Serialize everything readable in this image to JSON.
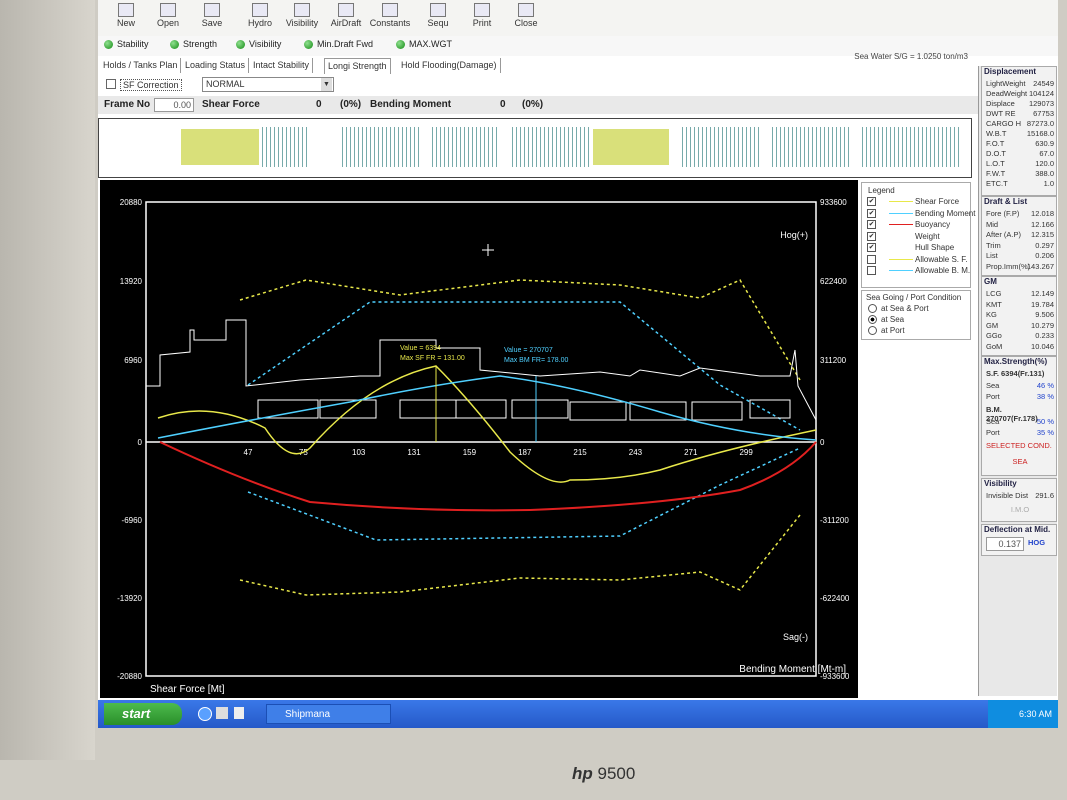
{
  "toolbar": {
    "buttons": [
      {
        "label": "New",
        "icon": "new-file-icon"
      },
      {
        "label": "Open",
        "icon": "open-folder-icon"
      },
      {
        "label": "Save",
        "icon": "save-disk-icon"
      },
      {
        "label": "Hydro",
        "icon": "hydro-table-icon"
      },
      {
        "label": "Visibility",
        "icon": "visibility-icon"
      },
      {
        "label": "AirDraft",
        "icon": "airdraft-icon"
      },
      {
        "label": "Constants",
        "icon": "constants-icon"
      },
      {
        "label": "Sequ",
        "icon": "sequence-icon"
      },
      {
        "label": "Print",
        "icon": "printer-icon"
      },
      {
        "label": "Close",
        "icon": "close-icon"
      }
    ]
  },
  "status_buttons": [
    "Stability",
    "Strength",
    "Visibility",
    "Min.Draft Fwd",
    "MAX.WGT"
  ],
  "sea_water": "Sea Water S/G = 1.0250 ton/m3",
  "tabs": [
    "Holds / Tanks Plan",
    "Loading Status",
    "Intact Stability",
    "Longi Strength",
    "Hold Flooding(Damage)"
  ],
  "active_tab": "Longi Strength",
  "sf_correction": "SF Correction",
  "mode_select": "NORMAL",
  "frame": {
    "label": "Frame No",
    "value": "0.00"
  },
  "shear_force": {
    "label": "Shear Force",
    "value": "0",
    "pct": "(0%)"
  },
  "bending_moment": {
    "label": "Bending Moment",
    "value": "0",
    "pct": "(0%)"
  },
  "chart_axes": {
    "left_ticks": [
      "20880",
      "13920",
      "6960",
      "0",
      "-6960",
      "-13920",
      "-20880"
    ],
    "right_ticks": [
      "933600",
      "622400",
      "311200",
      "0",
      "-311200",
      "-622400",
      "-933600"
    ],
    "x_ticks": [
      "47",
      "75",
      "103",
      "131",
      "159",
      "187",
      "215",
      "243",
      "271",
      "299"
    ],
    "hog": "Hog(+)",
    "sag": "Sag(-)",
    "xlabel": "Shear Force [Mt]",
    "xlabel_right": "Bending Moment [Mt-m]"
  },
  "annot_sf": {
    "value": "Value = 6394",
    "max": "Max SF FR = 131.00"
  },
  "annot_bm": {
    "value": "Value = 270707",
    "max": "Max BM FR= 178.00"
  },
  "legend": {
    "title": "Legend",
    "items": [
      {
        "label": "Shear Force",
        "color": "#e8e84a",
        "checked": true
      },
      {
        "label": "Bending Moment",
        "color": "#4fd0ff",
        "checked": true
      },
      {
        "label": "Buoyancy",
        "color": "#e02020",
        "checked": true
      },
      {
        "label": "Weight",
        "color": "#ffffff",
        "checked": true
      },
      {
        "label": "Hull Shape",
        "color": "#ffffff",
        "checked": true
      },
      {
        "label": "Allowable S. F.",
        "color": "#e8e84a",
        "checked": false
      },
      {
        "label": "Allowable B. M.",
        "color": "#4fd0ff",
        "checked": false
      }
    ]
  },
  "condition": {
    "title": "Sea Going / Port Condition",
    "options": [
      "at Sea & Port",
      "at Sea",
      "at Port"
    ],
    "selected": "at Sea"
  },
  "displacement": {
    "title": "Displacement",
    "rows": [
      [
        "LightWeight",
        "24549"
      ],
      [
        "DeadWeight",
        "104124"
      ],
      [
        "Displace",
        "129073"
      ],
      [
        "DWT RE",
        "67753"
      ],
      [
        "CARGO H",
        "87273.0"
      ],
      [
        "W.B.T",
        "15168.0"
      ],
      [
        "F.O.T",
        "630.9"
      ],
      [
        "D.O.T",
        "67.0"
      ],
      [
        "L.O.T",
        "120.0"
      ],
      [
        "F.W.T",
        "388.0"
      ],
      [
        "ETC.T",
        "1.0"
      ]
    ]
  },
  "draft": {
    "title": "Draft & List",
    "rows": [
      [
        "Fore (F.P)",
        "12.018"
      ],
      [
        "Mid",
        "12.166"
      ],
      [
        "After (A.P)",
        "12.315"
      ],
      [
        "Trim",
        "0.297"
      ],
      [
        "List",
        "0.206"
      ],
      [
        "Prop.Imm(%)",
        "143.267"
      ]
    ]
  },
  "gm": {
    "title": "GM",
    "rows": [
      [
        "LCG",
        "12.149"
      ],
      [
        "KMT",
        "19.784"
      ],
      [
        "KG",
        "9.506"
      ],
      [
        "GM",
        "10.279"
      ],
      [
        "GGo",
        "0.233"
      ],
      [
        "GoM",
        "10.046"
      ]
    ]
  },
  "maxstrength": {
    "title": "Max.Strength(%)",
    "sf": "S.F.   6394(Fr.131)",
    "sf_sea": "46 %",
    "sf_port": "38 %",
    "bm": "B.M. 270707(Fr.178)",
    "bm_sea": "50 %",
    "bm_port": "35 %",
    "selected": "SELECTED COND.",
    "cond": "SEA"
  },
  "visibility": {
    "title": "Visibility",
    "label": "Invisible Dist",
    "value": "291.6",
    "imo": "I.M.O"
  },
  "deflection": {
    "title": "Deflection at Mid.",
    "value": "0.137",
    "type": "HOG"
  },
  "taskbar": {
    "start": "start",
    "task": "Shipmana",
    "time": "6:30 AM"
  },
  "brand": {
    "logo": "hp",
    "model": "9500"
  }
}
